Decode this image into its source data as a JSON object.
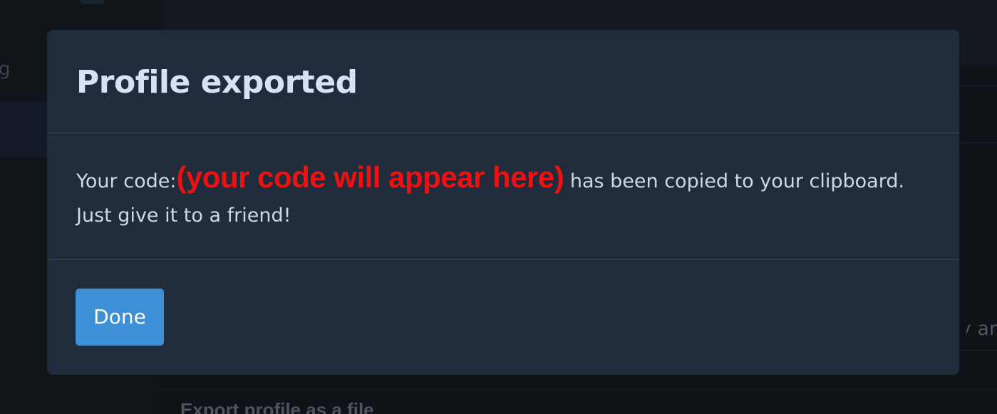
{
  "background": {
    "sidebar_glyph": "g",
    "cutoff_text": "ly ar",
    "export_heading": "Export profile as a file"
  },
  "modal": {
    "title": "Profile exported",
    "body": {
      "prefix": "Your code:",
      "code_placeholder": "(your code will appear here)",
      "suffix": "has been copied to your clipboard. Just give it to a friend!"
    },
    "done_label": "Done"
  },
  "colors": {
    "modal_background": "#202c3b",
    "title_text": "#d7e3f4",
    "body_text": "#cdd8e6",
    "code_placeholder": "#ee1111",
    "primary_button": "#3d8fd6"
  }
}
